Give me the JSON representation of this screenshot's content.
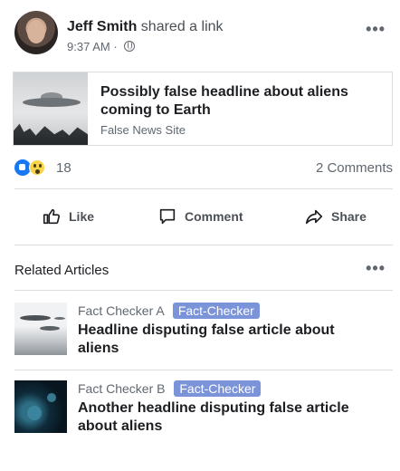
{
  "post": {
    "author": "Jeff Smith",
    "action": "shared a link",
    "time": "9:37 AM",
    "separator": "·",
    "more_icon": "more-horizontal-icon"
  },
  "link": {
    "headline": "Possibly false headline about aliens coming to Earth",
    "site": "False News Site"
  },
  "reactions": {
    "count": "18",
    "comments": "2 Comments",
    "icons": [
      "like-reaction-icon",
      "wow-reaction-icon"
    ]
  },
  "actions": {
    "like": "Like",
    "comment": "Comment",
    "share": "Share"
  },
  "related": {
    "title": "Related Articles",
    "items": [
      {
        "source": "Fact Checker A",
        "badge": "Fact-Checker",
        "headline": "Headline disputing false article about aliens"
      },
      {
        "source": "Fact Checker B",
        "badge": "Fact-Checker",
        "headline": "Another headline disputing false article about aliens"
      }
    ]
  },
  "colors": {
    "brand_blue": "#1877f2",
    "badge": "#7b93d9",
    "text": "#1c1e21",
    "muted": "#606770"
  }
}
